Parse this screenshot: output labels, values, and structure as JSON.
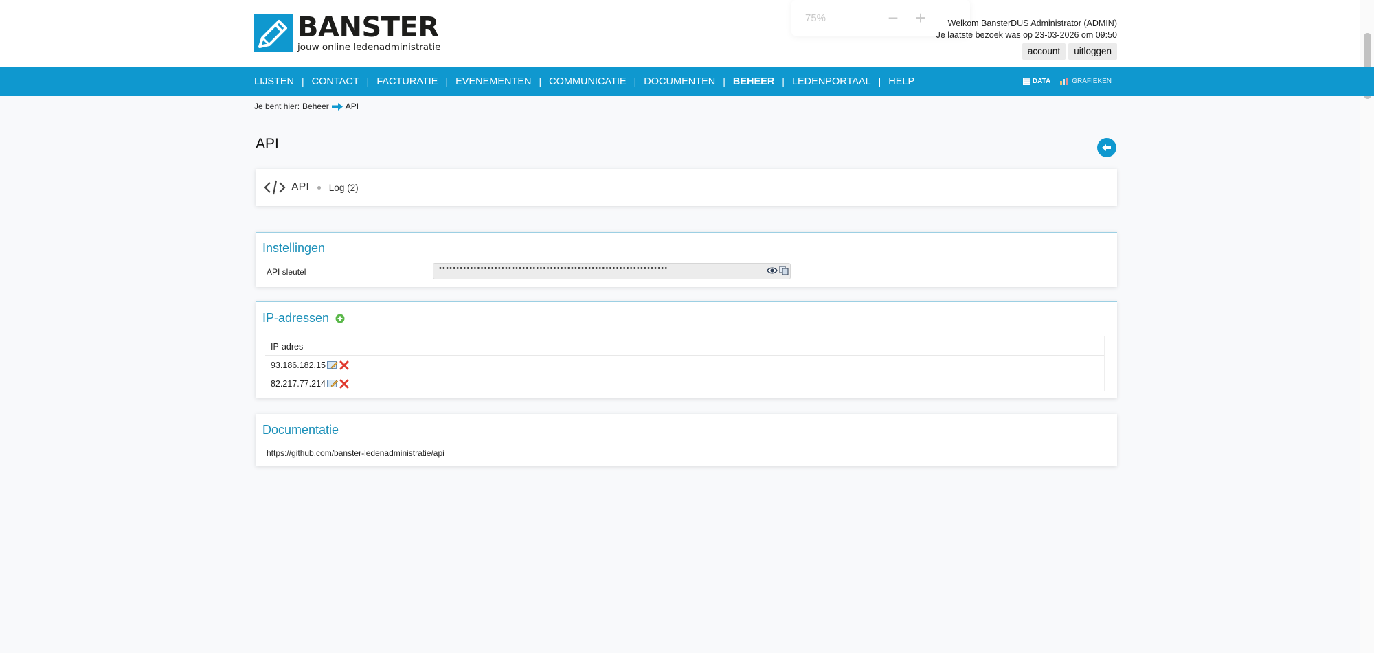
{
  "brand": {
    "name": "BANSTER",
    "tagline": "jouw online ledenadministratie",
    "color": "#0f98cf"
  },
  "zoom": {
    "level": "75%",
    "minus": "−",
    "plus": "+"
  },
  "user": {
    "welcome": "Welkom BansterDUS Administrator (ADMIN)",
    "last_visit": "Je laatste bezoek was op 23-03-2026 om 09:50",
    "account_label": "account",
    "logout_label": "uitloggen"
  },
  "nav": {
    "items": [
      {
        "label": "LIJSTEN"
      },
      {
        "label": "CONTACT"
      },
      {
        "label": "FACTURATIE"
      },
      {
        "label": "EVENEMENTEN"
      },
      {
        "label": "COMMUNICATIE"
      },
      {
        "label": "DOCUMENTEN"
      },
      {
        "label": "BEHEER"
      },
      {
        "label": "LEDENPORTAAL"
      },
      {
        "label": "HELP"
      }
    ],
    "separator": "|",
    "active_index": 6,
    "data_label": "DATA",
    "charts_label": "GRAFIEKEN"
  },
  "breadcrumb": {
    "prefix": "Je bent hier:",
    "parent": "Beheer",
    "current": "API"
  },
  "page": {
    "title": "API"
  },
  "tabs": {
    "api_label": "API",
    "log_label": "Log (2)"
  },
  "settings": {
    "title": "Instellingen",
    "api_key_label": "API sleutel",
    "api_key_masked": "••••••••••••••••••••••••••••••••••••••••••••••••••••••••••••••••••"
  },
  "ip_addresses": {
    "title": "IP-adressen",
    "column_header": "IP-adres",
    "rows": [
      {
        "ip": "93.186.182.15"
      },
      {
        "ip": "82.217.77.214"
      }
    ]
  },
  "documentation": {
    "title": "Documentatie",
    "link": "https://github.com/banster-ledenadministratie/api"
  }
}
